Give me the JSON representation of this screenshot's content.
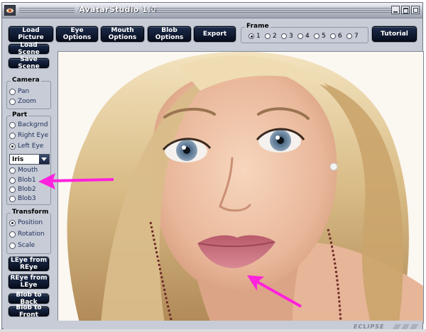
{
  "window": {
    "title": "AvatarStudio 1.0"
  },
  "toolbar": {
    "load_picture": "Load Picture",
    "eye_options": "Eye Options",
    "mouth_options": "Mouth\nOptions",
    "blob_options": "Blob Options",
    "export": "Export",
    "tutorial": "Tutorial"
  },
  "frame": {
    "title": "Frame",
    "selected": "1",
    "options": [
      "1",
      "2",
      "3",
      "4",
      "5",
      "6",
      "7"
    ]
  },
  "left_panel": {
    "load_scene": "Load Scene",
    "save_scene": "Save Scene",
    "camera": {
      "title": "Camera",
      "options": [
        "Pan",
        "Zoom"
      ],
      "selected": null
    },
    "part": {
      "title": "Part",
      "options": [
        "Backgrnd",
        "Right Eye",
        "Left Eye"
      ],
      "selected": "Left Eye",
      "dropdown_value": "Iris",
      "more_options": [
        "Mouth",
        "Blob1",
        "Blob2",
        "Blob3"
      ]
    },
    "transform": {
      "title": "Transform",
      "options": [
        "Position",
        "Rotation",
        "Scale"
      ],
      "selected": "Position"
    },
    "leye_from_reye": "LEye from\nREye",
    "reye_from_leye": "REye from\nLEye",
    "blob_to_back": "Blob to Back",
    "blob_to_front": "Blob to Front"
  },
  "status": {
    "logo_text": "ECLIPSE"
  },
  "colors": {
    "button_bg": "#0f1a33",
    "panel_bg": "#c7ccd6",
    "arrow": "#ff22dd"
  }
}
